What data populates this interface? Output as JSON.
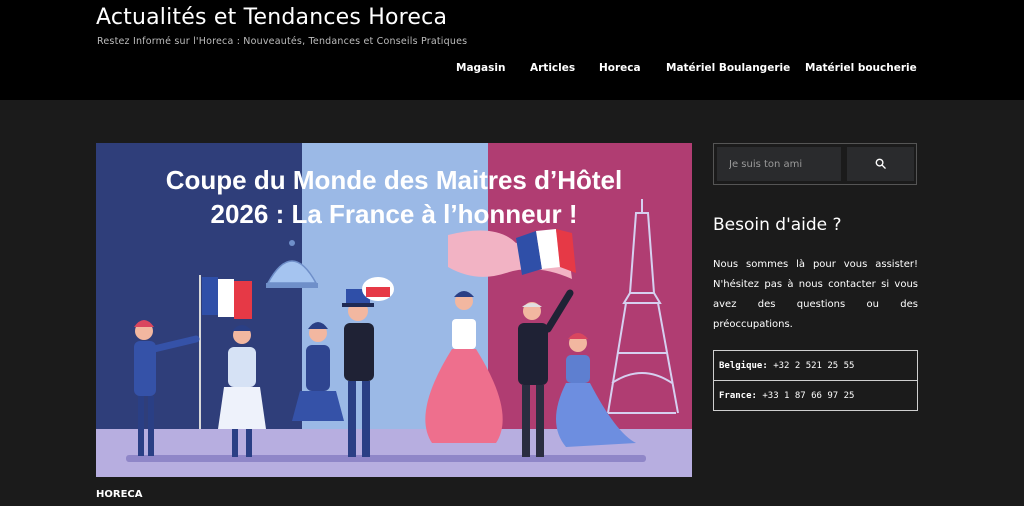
{
  "header": {
    "site_title": "Actualités et Tendances Horeca",
    "tagline": "Restez Informé sur l'Horeca : Nouveautés, Tendances et Conseils Pratiques",
    "nav": [
      {
        "label": "Magasin"
      },
      {
        "label": "Articles"
      },
      {
        "label": "Horeca"
      },
      {
        "label": "Matériel Boulangerie"
      },
      {
        "label": "Matériel boucherie"
      }
    ]
  },
  "article": {
    "hero_line1": "Coupe du Monde des Maitres d’Hôtel",
    "hero_line2": "2026 : La France à l’honneur !",
    "category": "HORECA"
  },
  "sidebar": {
    "search": {
      "placeholder": "Je suis ton ami"
    },
    "help_title": "Besoin d'aide ?",
    "help_text": "Nous sommes là pour vous assister! N'hésitez pas à nous contacter si vous avez des questions ou des préoccupations.",
    "contacts": [
      {
        "label": "Belgique:",
        "value": "+32 2 521 25 55"
      },
      {
        "label": "France:",
        "value": "+33 1 87 66 97 25"
      }
    ]
  },
  "colors": {
    "background": "#1b1b1b",
    "header": "#000000",
    "flag_blue": "#2f3e7a",
    "flag_white": "#9bb9e6",
    "flag_red": "#b03d72"
  }
}
